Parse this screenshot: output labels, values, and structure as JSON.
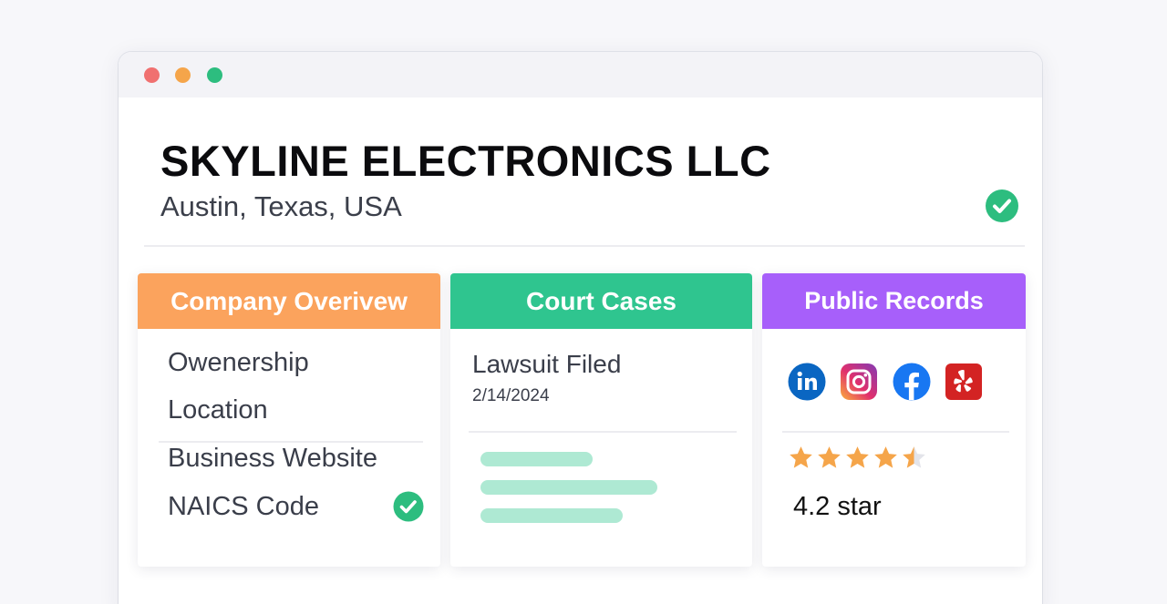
{
  "window": {
    "controls": [
      "close",
      "minimize",
      "maximize"
    ]
  },
  "company": {
    "name": "SKYLINE ELECTRONICS LLC",
    "location": "Austin, Texas, USA",
    "verified_icon": "check-circle-icon"
  },
  "cards": {
    "overview": {
      "title": "Company Overivew",
      "items": [
        "Owenership",
        "Location",
        "Business Website",
        "NAICS Code"
      ],
      "color": "#fba35d"
    },
    "court": {
      "title": "Court Cases",
      "case_title": "Lawsuit Filed",
      "case_date": "2/14/2024",
      "color": "#2fc58f"
    },
    "records": {
      "title": "Public Records",
      "socials": [
        "linkedin-icon",
        "instagram-icon",
        "facebook-icon",
        "yelp-icon"
      ],
      "rating_stars": 4.5,
      "rating_text": "4.2 star",
      "color": "#a75ffa"
    }
  }
}
